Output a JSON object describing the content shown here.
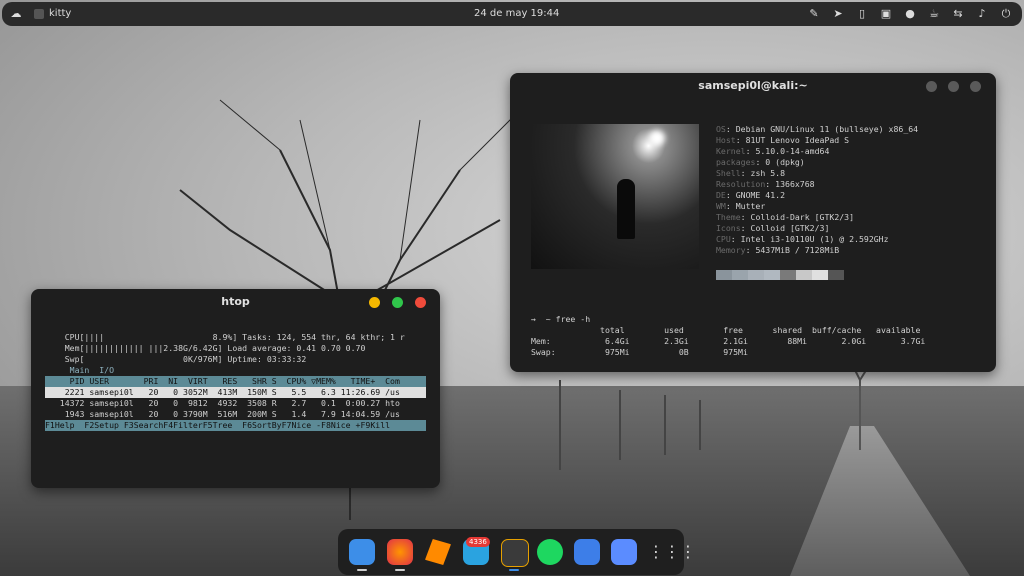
{
  "topbar": {
    "app_name": "kitty",
    "clock": "24 de may  19:44",
    "tray_icons": [
      "eyedropper-icon",
      "telegram-icon",
      "clipboard-icon",
      "screenshot-icon",
      "toggle-icon",
      "coffee-icon",
      "network-icon",
      "volume-icon",
      "power-icon"
    ]
  },
  "htop": {
    "title": "htop",
    "buttons": {
      "minimize_color": "#f5b800",
      "maximize_color": "#30c64b",
      "close_color": "#f04b3b"
    },
    "lines": [
      "",
      "",
      "    CPU[||||                      8.9%] Tasks: 124, 554 thr, 64 kthr; 1 r",
      "    Mem[|||||||||||| |||2.38G/6.42G] Load average: 0.41 0.70 0.70",
      "    Swp[                    0K/976M] Uptime: 03:33:32",
      "",
      "     Main  I/O",
      "     PID USER       PRI  NI  VIRT   RES   SHR S  CPU% ▽MEM%   TIME+  Com",
      "    2221 samsepi0l   20   0 3052M  413M  150M S   5.5   6.3 11:26.69 /us",
      "   14372 samsepi0l   20   0  9812  4932  3508 R   2.7   0.1  0:00.27 hto",
      "    1943 samsepi0l   20   0 3790M  516M  200M S   1.4   7.9 14:04.59 /us",
      "F1Help  F2Setup F3SearchF4FilterF5Tree  F6SortByF7Nice -F8Nice +F9Kill"
    ]
  },
  "fetch": {
    "title": "samsepi0l@kali:~",
    "info": [
      {
        "key": "OS",
        "value": "Debian GNU/Linux 11 (bullseye) x86_64"
      },
      {
        "key": "Host",
        "value": "81UT Lenovo IdeaPad S"
      },
      {
        "key": "Kernel",
        "value": "5.10.0-14-amd64"
      },
      {
        "key": "packages",
        "value": "0 (dpkg)"
      },
      {
        "key": "Shell",
        "value": "zsh 5.8"
      },
      {
        "key": "Resolution",
        "value": "1366x768"
      },
      {
        "key": "DE",
        "value": "GNOME 41.2"
      },
      {
        "key": "WM",
        "value": "Mutter"
      },
      {
        "key": "Theme",
        "value": "Colloid-Dark [GTK2/3]"
      },
      {
        "key": "Icons",
        "value": "Colloid [GTK2/3]"
      },
      {
        "key": "CPU",
        "value": "Intel i3-10110U (1) @ 2.592GHz"
      },
      {
        "key": "Memory",
        "value": "5437MiB / 7128MiB"
      }
    ],
    "swatch_colors": [
      "#8a949c",
      "#9aa4ac",
      "#a8b0b8",
      "#b0b8c0",
      "#7a7a7a",
      "#c8c8c8",
      "#e0e0e0",
      "#555555"
    ],
    "prompt": "→  ~ free -h",
    "free_header": "              total        used        free      shared  buff/cache   available",
    "free_rows": [
      "Mem:           6.4Gi       2.3Gi       2.1Gi        88Mi       2.0Gi       3.7Gi",
      "Swap:          975Mi          0B       975Mi"
    ]
  },
  "dock": {
    "badge": "4336",
    "items": [
      "files-icon",
      "firefox-icon",
      "sublime-icon",
      "telegram-icon",
      "terminal-icon",
      "spotify-icon",
      "settings-icon",
      "zoom-icon",
      "app-grid-icon"
    ]
  }
}
